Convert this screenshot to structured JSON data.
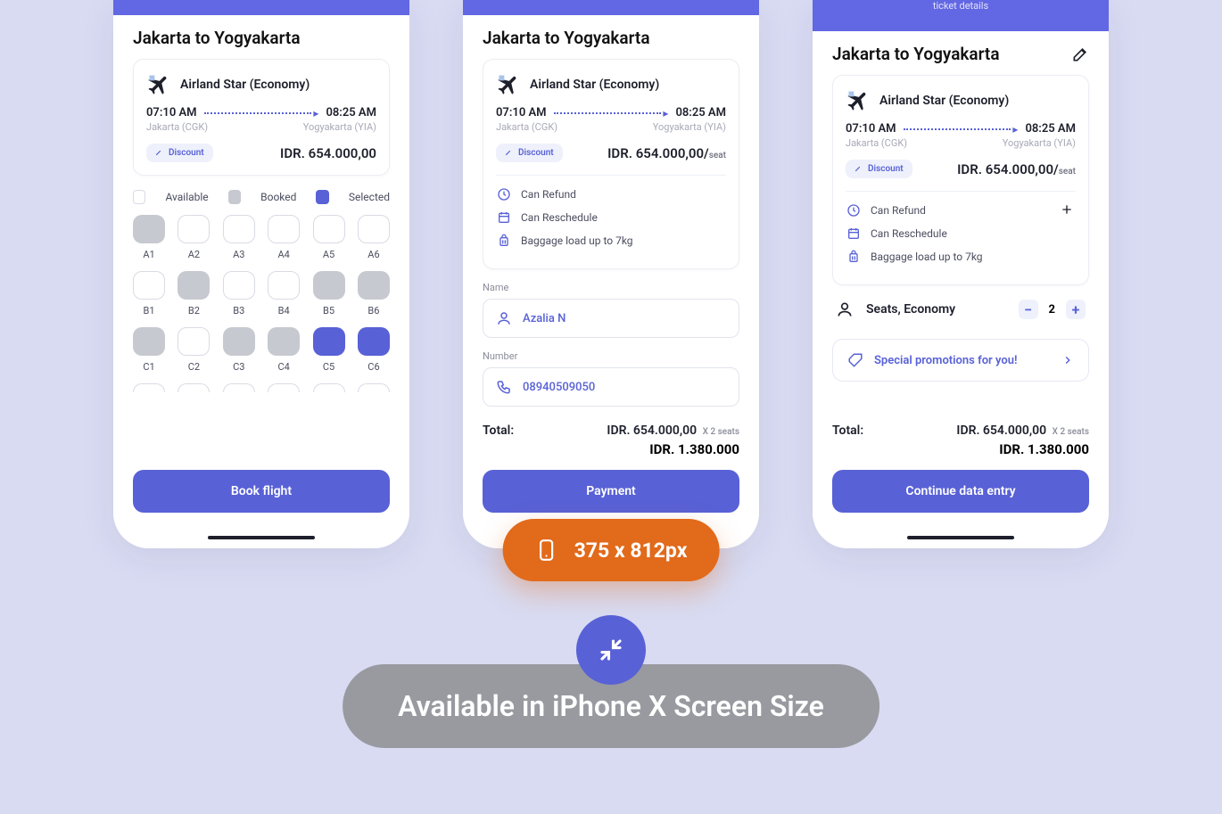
{
  "route_title": "Jakarta to Yogyakarta",
  "ticket_details_hint": "ticket details",
  "airline": {
    "name": "Airland Star (Economy)",
    "depart_time": "07:10 AM",
    "arrive_time": "08:25 AM",
    "depart_airport": "Jakarta (CGK)",
    "arrive_airport": "Yogyakarta (YIA)"
  },
  "discount_label": "Discount",
  "price": "IDR. 654.000,00",
  "price_per_seat": "IDR. 654.000,00/",
  "seat_suffix": "seat",
  "features": {
    "refund": "Can Refund",
    "reschedule": "Can Reschedule",
    "baggage": "Baggage load up to 7kg"
  },
  "legend": {
    "available": "Available",
    "booked": "Booked",
    "selected": "Selected"
  },
  "seats": {
    "row_a": [
      {
        "id": "A1",
        "state": "b"
      },
      {
        "id": "A2",
        "state": "a"
      },
      {
        "id": "A3",
        "state": "a"
      },
      {
        "id": "A4",
        "state": "a"
      },
      {
        "id": "A5",
        "state": "a"
      },
      {
        "id": "A6",
        "state": "a"
      }
    ],
    "row_b": [
      {
        "id": "B1",
        "state": "a"
      },
      {
        "id": "B2",
        "state": "b"
      },
      {
        "id": "B3",
        "state": "a"
      },
      {
        "id": "B4",
        "state": "a"
      },
      {
        "id": "B5",
        "state": "b"
      },
      {
        "id": "B6",
        "state": "b"
      }
    ],
    "row_c": [
      {
        "id": "C1",
        "state": "b"
      },
      {
        "id": "C2",
        "state": "a"
      },
      {
        "id": "C3",
        "state": "b"
      },
      {
        "id": "C4",
        "state": "b"
      },
      {
        "id": "C5",
        "state": "s"
      },
      {
        "id": "C6",
        "state": "s"
      }
    ]
  },
  "form": {
    "name_label": "Name",
    "name_value": "Azalia N",
    "number_label": "Number",
    "number_value": "08940509050"
  },
  "seats_selector": {
    "label": "Seats, Economy",
    "value": "2"
  },
  "promo": "Special promotions for you!",
  "totals": {
    "label": "Total:",
    "unit": "IDR. 654.000,00",
    "mult": " X 2 seats",
    "grand": "IDR. 1.380.000"
  },
  "cta": {
    "book": "Book flight",
    "payment": "Payment",
    "continue": "Continue data entry"
  },
  "badge_dims": "375 x 812px",
  "pill_text": "Available in iPhone X Screen Size"
}
